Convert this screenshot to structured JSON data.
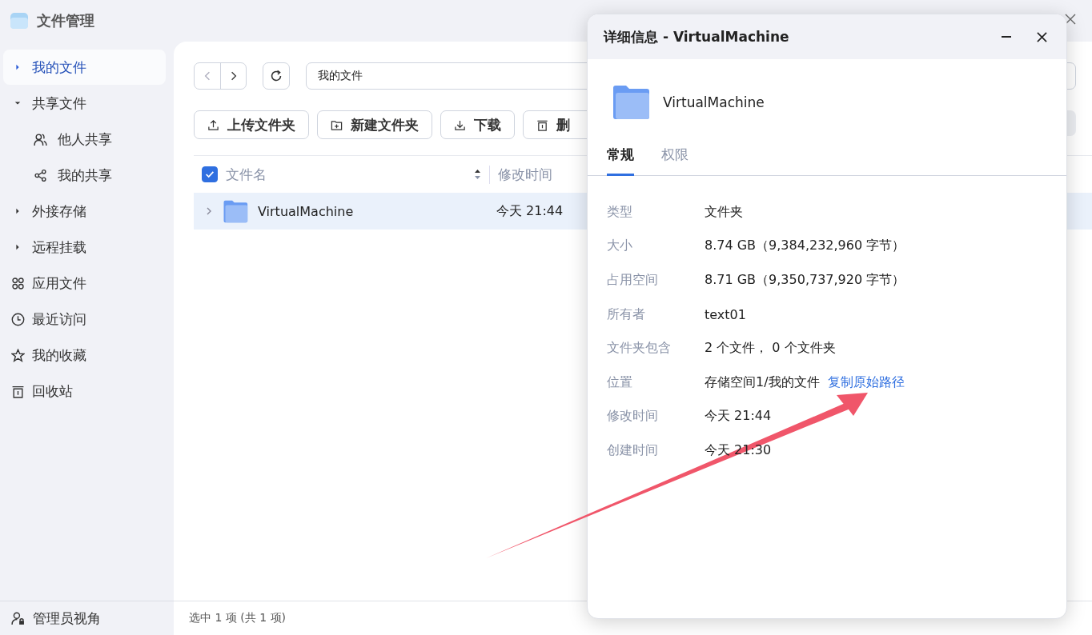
{
  "app": {
    "title": "文件管理"
  },
  "sidebar": {
    "items": [
      {
        "label": "我的文件",
        "kind": "expandable",
        "selected": true,
        "expanded": false
      },
      {
        "label": "共享文件",
        "kind": "expandable",
        "selected": false,
        "expanded": true,
        "children": [
          {
            "label": "他人共享",
            "kind": "icon",
            "selected": false
          },
          {
            "label": "我的共享",
            "kind": "icon",
            "selected": false
          }
        ]
      },
      {
        "label": "外接存储",
        "kind": "expandable",
        "selected": false,
        "expanded": false
      },
      {
        "label": "远程挂载",
        "kind": "expandable",
        "selected": false,
        "expanded": false
      },
      {
        "label": "应用文件",
        "kind": "icon",
        "selected": false
      },
      {
        "label": "最近访问",
        "kind": "icon",
        "selected": false
      },
      {
        "label": "我的收藏",
        "kind": "icon",
        "selected": false
      },
      {
        "label": "回收站",
        "kind": "icon",
        "selected": false
      }
    ],
    "footer": {
      "label": "管理员视角"
    }
  },
  "path_field": {
    "value": "我的文件"
  },
  "actions": [
    {
      "label": "上传文件夹"
    },
    {
      "label": "新建文件夹"
    },
    {
      "label": "下载"
    },
    {
      "label": "删"
    }
  ],
  "table": {
    "all_checked": true,
    "columns": [
      "文件名",
      "修改时间"
    ],
    "rows": [
      {
        "name": "VirtualMachine",
        "modified": "今天 21:44",
        "selected": true,
        "expanded": false
      }
    ]
  },
  "status_bar": "选中 1 项  (共 1 项)",
  "dialog": {
    "title": "详细信息 - VirtualMachine",
    "name": "VirtualMachine",
    "tabs": [
      {
        "label": "常规",
        "selected": true
      },
      {
        "label": "权限",
        "selected": false
      }
    ],
    "properties": [
      {
        "label": "类型",
        "value": "文件夹"
      },
      {
        "label": "大小",
        "value": "8.74 GB（9,384,232,960 字节）"
      },
      {
        "label": "占用空间",
        "value": "8.71 GB（9,350,737,920 字节）"
      },
      {
        "label": "所有者",
        "value": "text01"
      },
      {
        "label": "文件夹包含",
        "value": "2 个文件， 0 个文件夹"
      },
      {
        "label": "位置",
        "value": "存储空间1/我的文件",
        "link": "复制原始路径"
      },
      {
        "label": "修改时间",
        "value": "今天 21:44"
      },
      {
        "label": "创建时间",
        "value": "今天 21:30"
      }
    ]
  }
}
